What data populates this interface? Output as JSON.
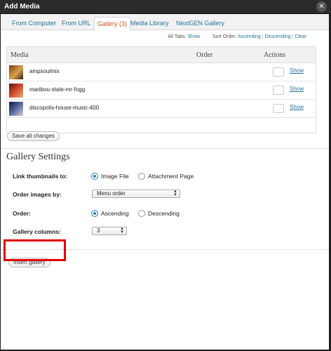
{
  "window": {
    "title": "Add Media",
    "close_glyph": "✕"
  },
  "tabs": [
    {
      "label": "From Computer",
      "active": false
    },
    {
      "label": "From URL",
      "active": false
    },
    {
      "label": "Gallery (3)",
      "active": true
    },
    {
      "label": "Media Library",
      "active": false
    },
    {
      "label": "NextGEN Gallery",
      "active": false
    }
  ],
  "sortbar": {
    "all_tabs_label": "All Tabs:",
    "all_tabs_link": "Show",
    "sort_label": "Sort Order:",
    "ascending": "Ascending",
    "descending": "Descending",
    "clear": "Clear",
    "separator": "|"
  },
  "table": {
    "headers": {
      "media": "Media",
      "order": "Order",
      "actions": "Actions"
    },
    "rows": [
      {
        "title": "ampsoulmix",
        "action": "Show",
        "thumb_color": "#c98a3a"
      },
      {
        "title": "maribou-state-mr-fogg",
        "action": "Show",
        "thumb_color": "#b23a2e"
      },
      {
        "title": "discopolis-house-music-400",
        "action": "Show",
        "thumb_color": "#2b3b6e"
      }
    ]
  },
  "save_all_label": "Save all changes",
  "gallery_settings": {
    "heading": "Gallery Settings",
    "link_thumbnails": {
      "label": "Link thumbnails to:",
      "options": [
        {
          "label": "Image File",
          "selected": true
        },
        {
          "label": "Attachment Page",
          "selected": false
        }
      ]
    },
    "order_images_by": {
      "label": "Order images by:",
      "value": "Menu order"
    },
    "order": {
      "label": "Order:",
      "options": [
        {
          "label": "Ascending",
          "selected": true
        },
        {
          "label": "Descending",
          "selected": false
        }
      ]
    },
    "gallery_columns": {
      "label": "Gallery columns:",
      "value": "3"
    }
  },
  "insert_gallery_label": "Insert gallery",
  "colors": {
    "link": "#21759b",
    "active_tab": "#d54e21",
    "highlight": "#e00000"
  }
}
